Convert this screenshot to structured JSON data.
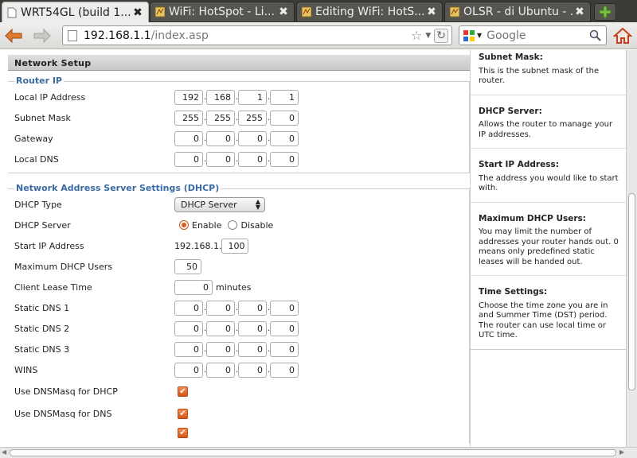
{
  "tabs": [
    {
      "title": "WRT54GL (build 1...",
      "active": true
    },
    {
      "title": "WiFi: HotSpot - Li...",
      "active": false
    },
    {
      "title": "Editing WiFi: HotS...",
      "active": false
    },
    {
      "title": "OLSR - di Ubuntu - ...",
      "active": false
    }
  ],
  "url": {
    "host": "192.168.1.1",
    "path": "/index.asp"
  },
  "search": {
    "placeholder": "Google"
  },
  "page": {
    "section_title": "Network Setup",
    "router_ip": {
      "legend": "Router IP",
      "rows": [
        {
          "label": "Local IP Address",
          "octets": [
            "192",
            "168",
            "1",
            "1"
          ]
        },
        {
          "label": "Subnet Mask",
          "octets": [
            "255",
            "255",
            "255",
            "0"
          ]
        },
        {
          "label": "Gateway",
          "octets": [
            "0",
            "0",
            "0",
            "0"
          ]
        },
        {
          "label": "Local DNS",
          "octets": [
            "0",
            "0",
            "0",
            "0"
          ]
        }
      ]
    },
    "dhcp": {
      "legend": "Network Address Server Settings (DHCP)",
      "type_label": "DHCP Type",
      "type_value": "DHCP Server",
      "server_label": "DHCP Server",
      "enable_label": "Enable",
      "disable_label": "Disable",
      "start_label": "Start IP Address",
      "start_prefix": "192.168.1.",
      "start_value": "100",
      "max_label": "Maximum DHCP Users",
      "max_value": "50",
      "lease_label": "Client Lease Time",
      "lease_value": "0",
      "lease_unit": "minutes",
      "ip_rows": [
        {
          "label": "Static DNS 1",
          "octets": [
            "0",
            "0",
            "0",
            "0"
          ]
        },
        {
          "label": "Static DNS 2",
          "octets": [
            "0",
            "0",
            "0",
            "0"
          ]
        },
        {
          "label": "Static DNS 3",
          "octets": [
            "0",
            "0",
            "0",
            "0"
          ]
        },
        {
          "label": "WINS",
          "octets": [
            "0",
            "0",
            "0",
            "0"
          ]
        }
      ],
      "dnsmasq_dhcp_label": "Use DNSMasq for DHCP",
      "dnsmasq_dns_label": "Use DNSMasq for DNS"
    }
  },
  "help": [
    {
      "title": "Subnet Mask:",
      "text": "This is the subnet mask of the router."
    },
    {
      "title": "DHCP Server:",
      "text": "Allows the router to manage your IP addresses."
    },
    {
      "title": "Start IP Address:",
      "text": "The address you would like to start with."
    },
    {
      "title": "Maximum DHCP Users:",
      "text": "You may limit the number of addresses your router hands out. 0 means only predefined static leases will be handed out."
    },
    {
      "title": "Time Settings:",
      "text": "Choose the time zone you are in and Summer Time (DST) period. The router can use local time or UTC time."
    }
  ],
  "colors": {
    "accent": "#e05a1c",
    "legend": "#3a6aa3"
  }
}
